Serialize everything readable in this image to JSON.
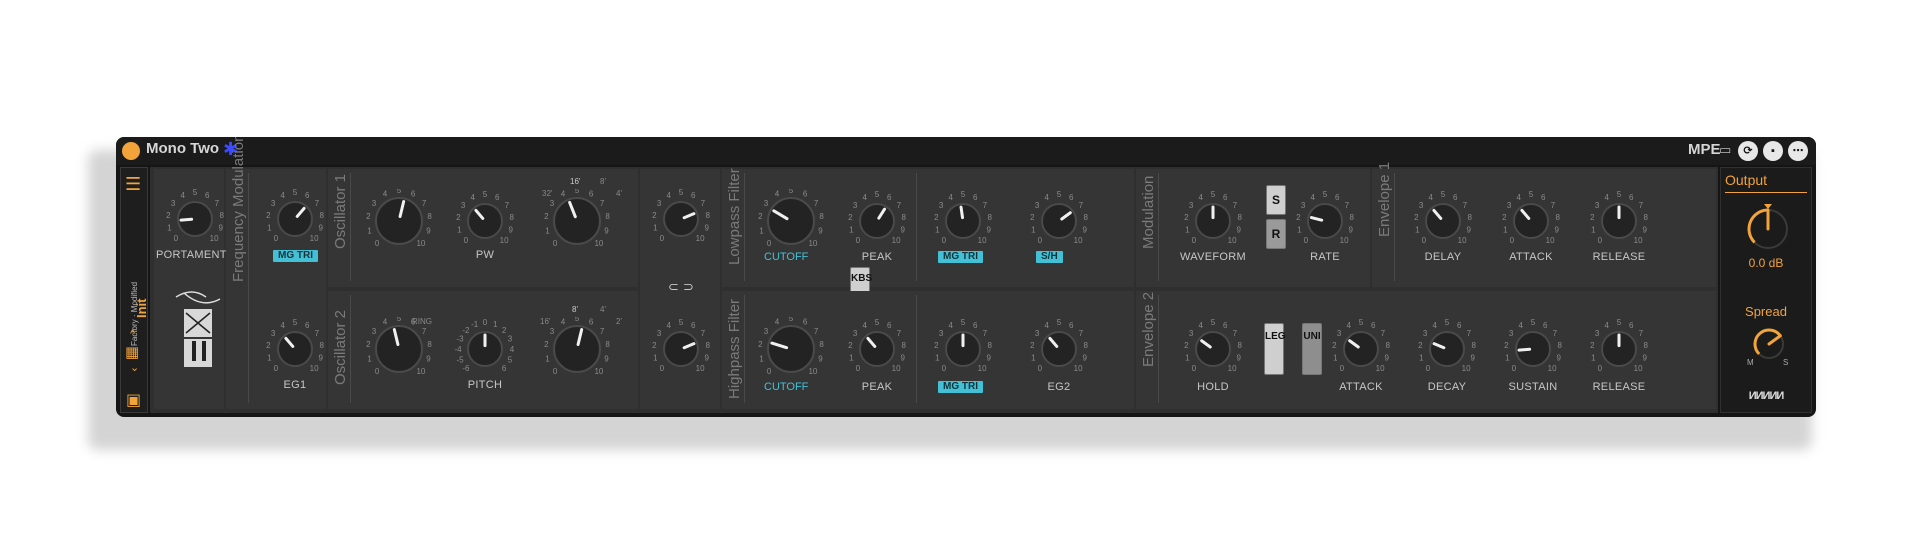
{
  "device": {
    "title": "Mono Two",
    "mpe_label": "MPE",
    "colors": {
      "accent": "#f2a33a",
      "chip": "#43c0d6",
      "panel": "#2f2f2f",
      "mpe_icon": "#3b4bff"
    }
  },
  "titlebar": {
    "icons": [
      "calendar-icon",
      "refresh-icon",
      "save-icon",
      "more-icon"
    ]
  },
  "sidebar": {
    "preset_path": "Factory · Modified",
    "preset_name": "Init",
    "nav_up": "^",
    "nav_down": "⌄"
  },
  "sections": {
    "freq_mod": "Frequency Modulation",
    "osc1": "Oscillator 1",
    "osc2": "Oscillator 2",
    "lowpass": "Lowpass Filter",
    "highpass": "Highpass Filter",
    "modulation": "Modulation",
    "env1": "Envelope 1",
    "env2": "Envelope 2",
    "output": "Output"
  },
  "knobs": {
    "portamento": {
      "label": "PORTAMENTO",
      "value": 0.15
    },
    "fm_top": {
      "label": "",
      "chip": "MG TRI",
      "value": 0.65
    },
    "fm_eg1": {
      "label": "EG1",
      "value": 0.35
    },
    "osc1_shape": {
      "label": "",
      "value": 0.55
    },
    "osc1_pw": {
      "label": "PW",
      "value": 0.35
    },
    "osc1_oct": {
      "label": "",
      "value": 0.42
    },
    "osc2_shape": {
      "label": "",
      "value": 0.45
    },
    "osc2_pitch": {
      "label": "PITCH",
      "value": 0.5
    },
    "osc2_oct": {
      "label": "",
      "value": 0.55
    },
    "mix_top": {
      "label": "",
      "value": 0.75
    },
    "mix_bot": {
      "label": "",
      "value": 0.75
    },
    "lp_cutoff": {
      "label": "CUTOFF",
      "value": 0.28
    },
    "lp_peak": {
      "label": "PEAK",
      "value": 0.62
    },
    "lp_mg": {
      "label": "",
      "chip": "MG TRI",
      "value": 0.47
    },
    "lp_sh": {
      "label": "",
      "chip": "S/H",
      "value": 0.7
    },
    "hp_cutoff": {
      "label": "CUTOFF",
      "value": 0.23
    },
    "hp_peak": {
      "label": "PEAK",
      "value": 0.35
    },
    "hp_mg": {
      "label": "",
      "chip": "MG TRI",
      "value": 0.5
    },
    "hp_eg2": {
      "label": "EG2",
      "value": 0.35
    },
    "mod_waveform": {
      "label": "WAVEFORM",
      "value": 0.5
    },
    "mod_rate": {
      "label": "RATE",
      "value": 0.22
    },
    "env1_delay": {
      "label": "DELAY",
      "value": 0.35
    },
    "env1_attack": {
      "label": "ATTACK",
      "value": 0.35
    },
    "env1_release": {
      "label": "RELEASE",
      "value": 0.5
    },
    "env2_hold": {
      "label": "HOLD",
      "value": 0.3
    },
    "env2_attack": {
      "label": "ATTACK",
      "value": 0.3
    },
    "env2_decay": {
      "label": "DECAY",
      "value": 0.25
    },
    "env2_sustain": {
      "label": "SUSTAIN",
      "value": 0.15
    },
    "env2_release": {
      "label": "RELEASE",
      "value": 0.5
    }
  },
  "scale": {
    "numbers": [
      "0",
      "1",
      "2",
      "3",
      "4",
      "5",
      "6",
      "7",
      "8",
      "9",
      "10"
    ]
  },
  "osc1_ticks": {
    "t16": "16'",
    "t8": "8'",
    "t4": "4'",
    "t32": "32'"
  },
  "osc2_ticks": {
    "ring": "RING",
    "t16": "16'",
    "t8": "8'",
    "t4": "4'",
    "t2": "2'",
    "pitch_scale": [
      "-6",
      "-5",
      "-4",
      "-3",
      "-2",
      "-1",
      "0",
      "1",
      "2",
      "3",
      "4",
      "5",
      "6"
    ]
  },
  "buttons": {
    "s": "S",
    "r": "R",
    "kbs": "KBS",
    "leg": "LEG",
    "uni": "UNI",
    "link": "⊂ ⊃"
  },
  "output": {
    "title": "Output",
    "gain_value": "0.0 dB",
    "gain": 0.5,
    "spread_label": "Spread",
    "spread": 0.7,
    "m": "M",
    "s": "S",
    "logo": "ИИИИИ"
  }
}
